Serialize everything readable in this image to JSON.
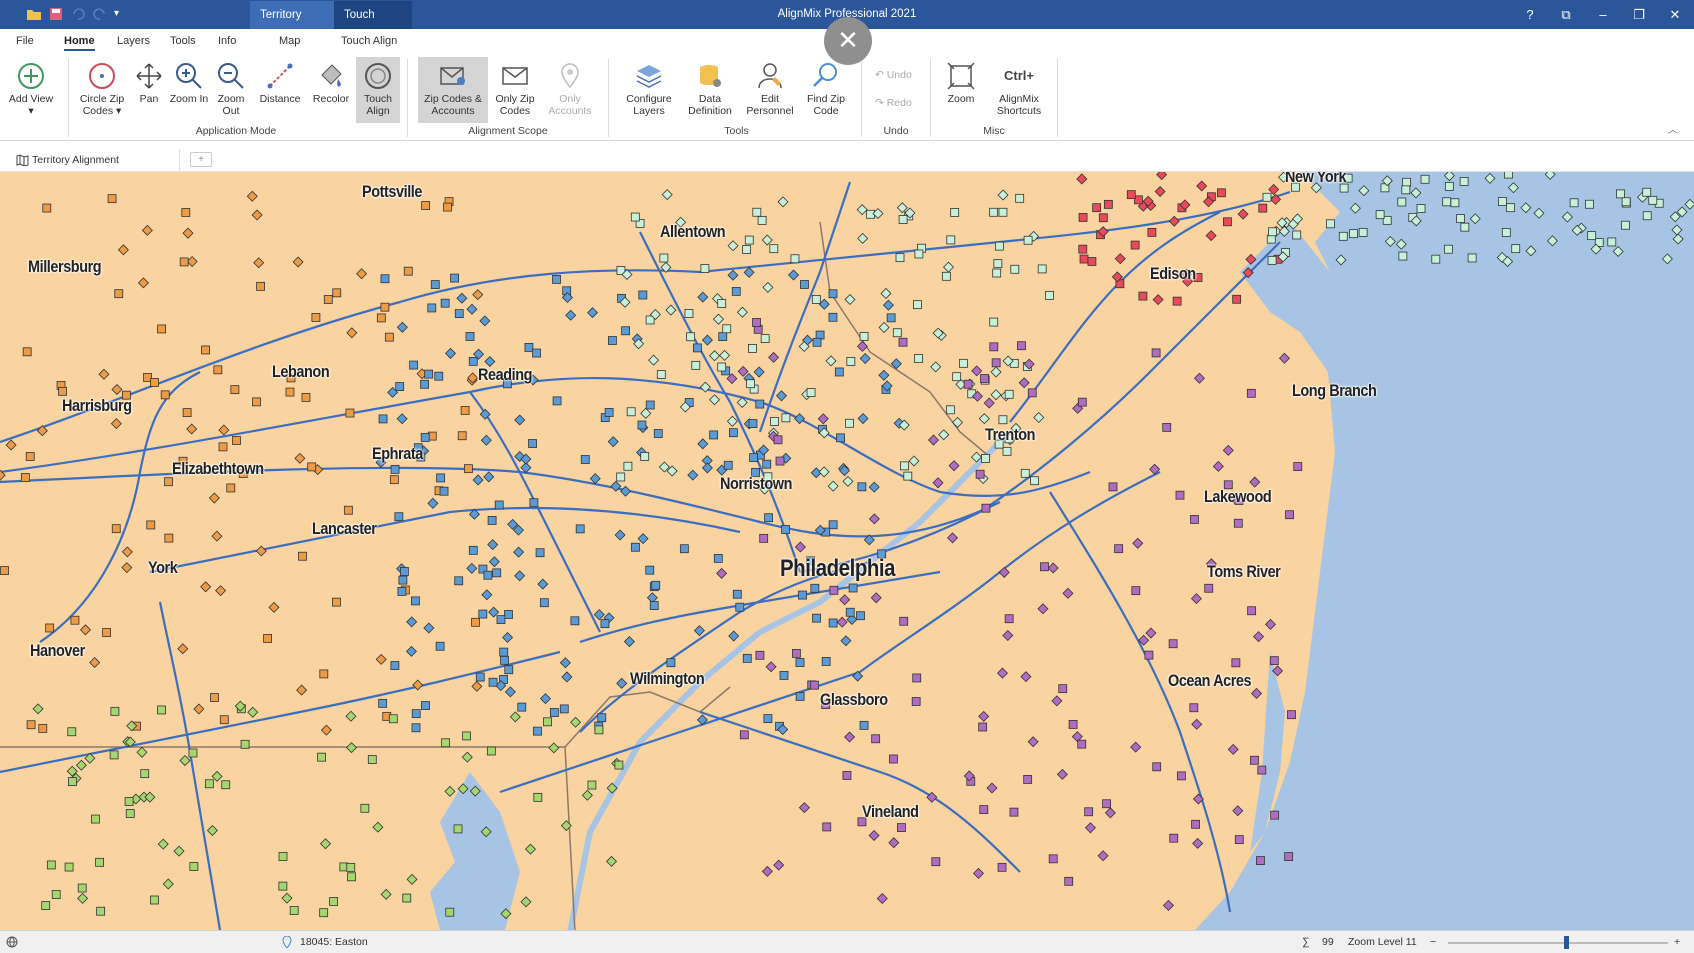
{
  "titlebar": {
    "app_title": "AlignMix Professional 2021",
    "context_tabs": [
      "Territory Map",
      "Touch Align"
    ],
    "buttons": [
      "?",
      "⧉",
      "–",
      "❐",
      "✕"
    ]
  },
  "ribbon_tabs": [
    "File",
    "Home",
    "Layers",
    "Tools",
    "Info",
    "Map",
    "Touch Align"
  ],
  "ribbon": {
    "buttons": [
      {
        "label": "Add View ▾",
        "icon": "add-icon"
      },
      {
        "label": "Circle Zip Codes ▾",
        "icon": "circle-icon"
      },
      {
        "label": "Pan",
        "icon": "pan-icon"
      },
      {
        "label": "Zoom In",
        "icon": "zoom-in-icon"
      },
      {
        "label": "Zoom Out",
        "icon": "zoom-out-icon"
      },
      {
        "label": "Distance",
        "icon": "ruler-icon"
      },
      {
        "label": "Recolor",
        "icon": "paint-icon"
      },
      {
        "label": "Touch Align",
        "icon": "touch-align-icon"
      },
      {
        "label": "Zip Codes & Accounts",
        "icon": "envelope-pin-icon"
      },
      {
        "label": "Only Zip Codes",
        "icon": "envelope-icon"
      },
      {
        "label": "Only Accounts",
        "icon": "pin-icon"
      },
      {
        "label": "Configure Layers",
        "icon": "layers-icon"
      },
      {
        "label": "Data Definition",
        "icon": "database-icon"
      },
      {
        "label": "Edit Personnel",
        "icon": "person-icon"
      },
      {
        "label": "Find Zip Code",
        "icon": "search-icon"
      },
      {
        "label": "Zoom",
        "icon": "zoom-extent-icon"
      },
      {
        "label": "AlignMix Shortcuts",
        "icon": "ctrl-plus-icon"
      }
    ],
    "undo": "Undo",
    "redo": "Redo",
    "groups": [
      "Application Mode",
      "Alignment Scope",
      "Tools",
      "Undo",
      "Misc"
    ],
    "ctrl_text": "Ctrl+"
  },
  "document_tab": {
    "label": "Territory Alignment",
    "new_tab": "+"
  },
  "map": {
    "colors": {
      "land": "#f9d3a0",
      "water": "#a8c4e4",
      "road": "#3b6dc0",
      "border": "#8a7a6a",
      "blue_territory": "#5b9bd5",
      "green_territory": "#a5d66f",
      "orange_territory": "#ed9b45",
      "purple_territory": "#b06cc0",
      "red_territory": "#e84a5a",
      "mint_territory": "#c8f0d8"
    },
    "cities": [
      {
        "name": "Pottsville"
      },
      {
        "name": "Allentown"
      },
      {
        "name": "New York"
      },
      {
        "name": "Millersburg"
      },
      {
        "name": "Edison"
      },
      {
        "name": "Lebanon"
      },
      {
        "name": "Reading"
      },
      {
        "name": "Long Branch"
      },
      {
        "name": "Harrisburg"
      },
      {
        "name": "Trenton"
      },
      {
        "name": "Ephrata"
      },
      {
        "name": "Elizabethtown"
      },
      {
        "name": "Norristown"
      },
      {
        "name": "Lakewood"
      },
      {
        "name": "Lancaster"
      },
      {
        "name": "Philadelphia"
      },
      {
        "name": "York"
      },
      {
        "name": "Toms River"
      },
      {
        "name": "Hanover"
      },
      {
        "name": "Ocean Acres"
      },
      {
        "name": "Wilmington"
      },
      {
        "name": "Glassboro"
      },
      {
        "name": "Vineland"
      }
    ]
  },
  "statusbar": {
    "location": "18045: Easton",
    "count_symbol": "∑",
    "count": "99",
    "zoom_level": "Zoom Level 11",
    "zoom_minus": "−",
    "zoom_plus": "+"
  }
}
